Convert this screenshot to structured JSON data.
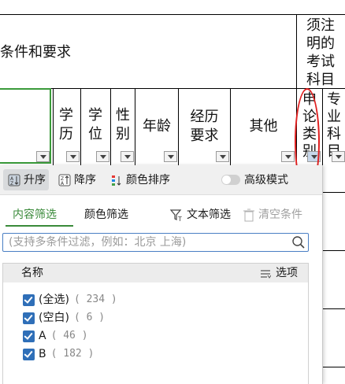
{
  "sheet": {
    "header_conditions": "条件和要求",
    "header_exam": [
      "须注",
      "明的",
      "考试",
      "科目"
    ],
    "col_education": [
      "学",
      "历"
    ],
    "col_degree": [
      "学",
      "位"
    ],
    "col_gender": [
      "性",
      "别"
    ],
    "col_age": "年龄",
    "col_experience": [
      "经历",
      "要求"
    ],
    "col_other": "其他",
    "col_essay": [
      "申",
      "论",
      "类",
      "别"
    ],
    "col_major": [
      "专",
      "业",
      "科",
      "目"
    ]
  },
  "filter_panel": {
    "sort_asc": "升序",
    "sort_desc": "降序",
    "sort_color": "颜色排序",
    "advanced_mode": "高级模式",
    "advanced_mode_on": false,
    "tab_content": "内容筛选",
    "tab_color": "颜色筛选",
    "text_filter": "文本筛选",
    "clear_conditions": "清空条件",
    "search_placeholder": "(支持多条件过滤，例如：北京 上海)",
    "list_header_name": "名称",
    "list_header_options": "选项",
    "items": [
      {
        "label": "(全选)",
        "count": "( 234 )",
        "checked": true
      },
      {
        "label": "(空白)",
        "count": "( 6 )",
        "checked": true
      },
      {
        "label": "A",
        "count": "( 46 )",
        "checked": true
      },
      {
        "label": "B",
        "count": "( 182 )",
        "checked": true
      }
    ]
  },
  "colors": {
    "accent_green": "#3a8a3a",
    "annotation_red": "#e02020",
    "checkbox_blue": "#2f6fb8"
  }
}
